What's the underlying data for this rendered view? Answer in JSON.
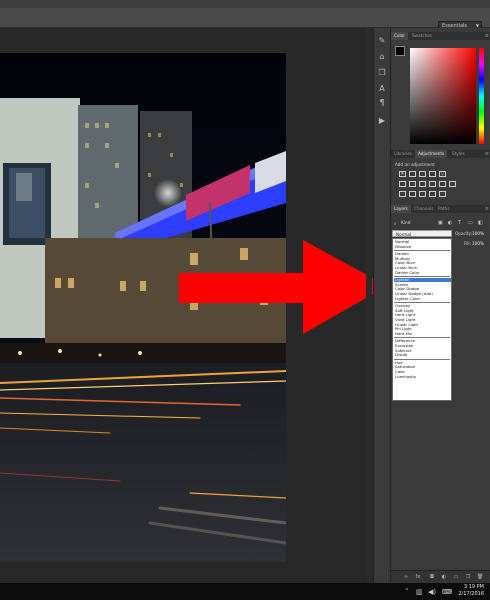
{
  "app": {
    "name": "Photoshop"
  },
  "options_bar": {
    "workspace": "Essentials"
  },
  "color_panel": {
    "tabs": [
      "Color",
      "Swatches"
    ],
    "foreground": "#000000",
    "background": "#ffffff",
    "selected_hue": "#ff0000"
  },
  "adjustments_panel": {
    "tabs": [
      "Libraries",
      "Adjustments",
      "Styles"
    ],
    "active_tab": "Adjustments",
    "hint": "Add an adjustment"
  },
  "layers_panel": {
    "tabs": [
      "Layers",
      "Channels",
      "Paths"
    ],
    "filter_kind": "Kind",
    "blend_mode": "Normal",
    "opacity_label": "Opacity:",
    "opacity_value": "100%",
    "fill_label": "Fill:",
    "fill_value": "100%",
    "blend_groups": [
      [
        "Normal",
        "Dissolve"
      ],
      [
        "Darken",
        "Multiply",
        "Color Burn",
        "Linear Burn",
        "Darker Color"
      ],
      [
        "Lighten",
        "Screen",
        "Color Dodge",
        "Linear Dodge (Add)",
        "Lighter Color"
      ],
      [
        "Overlay",
        "Soft Light",
        "Hard Light",
        "Vivid Light",
        "Linear Light",
        "Pin Light",
        "Hard Mix"
      ],
      [
        "Difference",
        "Exclusion",
        "Subtract",
        "Divide"
      ],
      [
        "Hue",
        "Saturation",
        "Color",
        "Luminosity"
      ]
    ],
    "highlighted_mode": "Lighten"
  },
  "annotation": {
    "arrow_color": "#ff0000"
  },
  "taskbar": {
    "time": "3:19 PM",
    "date": "2/17/2016"
  }
}
